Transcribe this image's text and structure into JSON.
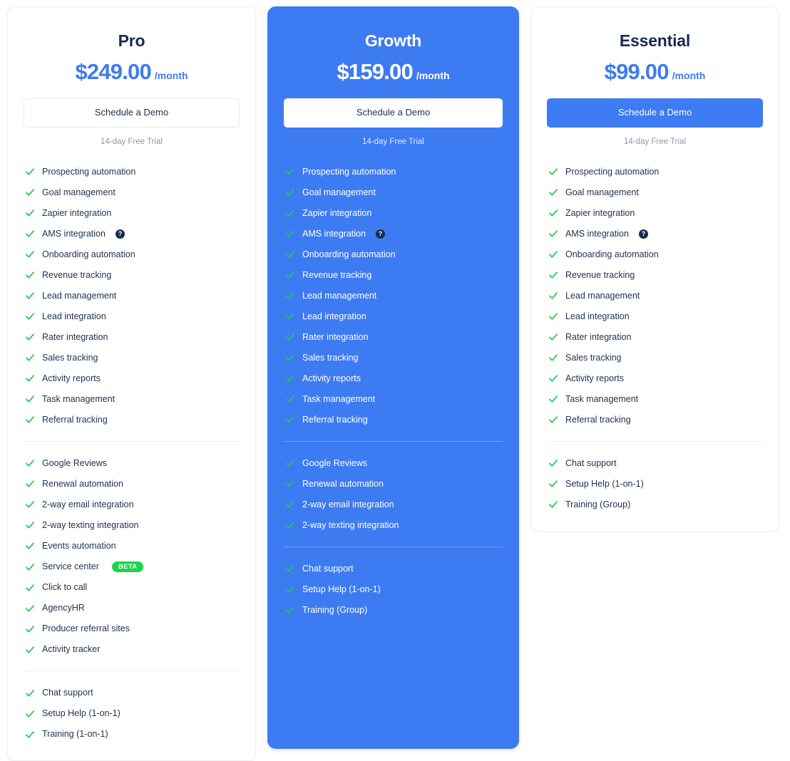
{
  "colors": {
    "accent_blue": "#3d7bf2",
    "check_green": "#22c94a",
    "badge_green": "#19d649",
    "heading_navy": "#182a4e",
    "muted_gray": "#8e98ad",
    "card_border": "#eef0f4"
  },
  "icons": {
    "check": "check-icon",
    "help": "?",
    "help_name": "help-icon"
  },
  "plans": [
    {
      "name": "Pro",
      "price": "$249.00",
      "period": "/month",
      "cta_label": "Schedule a Demo",
      "trial_note": "14-day Free Trial",
      "featured": false,
      "cta_style": "outline",
      "feature_groups": [
        {
          "items": [
            {
              "label": "Prospecting automation"
            },
            {
              "label": "Goal management"
            },
            {
              "label": "Zapier integration"
            },
            {
              "label": "AMS integration",
              "help": true
            },
            {
              "label": "Onboarding automation"
            },
            {
              "label": "Revenue tracking"
            },
            {
              "label": "Lead management"
            },
            {
              "label": "Lead integration"
            },
            {
              "label": "Rater integration"
            },
            {
              "label": "Sales tracking"
            },
            {
              "label": "Activity reports"
            },
            {
              "label": "Task management"
            },
            {
              "label": "Referral tracking"
            }
          ]
        },
        {
          "items": [
            {
              "label": "Google Reviews"
            },
            {
              "label": "Renewal automation"
            },
            {
              "label": "2-way email integration"
            },
            {
              "label": "2-way texting integration"
            },
            {
              "label": "Events automation"
            },
            {
              "label": "Service center",
              "badge": "BETA"
            },
            {
              "label": "Click to call"
            },
            {
              "label": "AgencyHR"
            },
            {
              "label": "Producer referral sites"
            },
            {
              "label": "Activity tracker"
            }
          ]
        },
        {
          "items": [
            {
              "label": "Chat support"
            },
            {
              "label": "Setup Help (1-on-1)"
            },
            {
              "label": "Training (1-on-1)"
            }
          ]
        }
      ]
    },
    {
      "name": "Growth",
      "price": "$159.00",
      "period": "/month",
      "cta_label": "Schedule a Demo",
      "trial_note": "14-day Free Trial",
      "featured": true,
      "cta_style": "white",
      "feature_groups": [
        {
          "items": [
            {
              "label": "Prospecting automation"
            },
            {
              "label": "Goal management"
            },
            {
              "label": "Zapier integration"
            },
            {
              "label": "AMS integration",
              "help": true
            },
            {
              "label": "Onboarding automation"
            },
            {
              "label": "Revenue tracking"
            },
            {
              "label": "Lead management"
            },
            {
              "label": "Lead integration"
            },
            {
              "label": "Rater integration"
            },
            {
              "label": "Sales tracking"
            },
            {
              "label": "Activity reports"
            },
            {
              "label": "Task management"
            },
            {
              "label": "Referral tracking"
            }
          ]
        },
        {
          "items": [
            {
              "label": "Google Reviews"
            },
            {
              "label": "Renewal automation"
            },
            {
              "label": "2-way email integration"
            },
            {
              "label": "2-way texting integration"
            }
          ]
        },
        {
          "items": [
            {
              "label": "Chat support"
            },
            {
              "label": "Setup Help (1-on-1)"
            },
            {
              "label": "Training (Group)"
            }
          ]
        }
      ]
    },
    {
      "name": "Essential",
      "price": "$99.00",
      "period": "/month",
      "cta_label": "Schedule a Demo",
      "trial_note": "14-day Free Trial",
      "featured": false,
      "cta_style": "solid",
      "feature_groups": [
        {
          "items": [
            {
              "label": "Prospecting automation"
            },
            {
              "label": "Goal management"
            },
            {
              "label": "Zapier integration"
            },
            {
              "label": "AMS integration",
              "help": true
            },
            {
              "label": "Onboarding automation"
            },
            {
              "label": "Revenue tracking"
            },
            {
              "label": "Lead management"
            },
            {
              "label": "Lead integration"
            },
            {
              "label": "Rater integration"
            },
            {
              "label": "Sales tracking"
            },
            {
              "label": "Activity reports"
            },
            {
              "label": "Task management"
            },
            {
              "label": "Referral tracking"
            }
          ]
        },
        {
          "items": [
            {
              "label": "Chat support"
            },
            {
              "label": "Setup Help (1-on-1)"
            },
            {
              "label": "Training (Group)"
            }
          ]
        }
      ]
    }
  ]
}
